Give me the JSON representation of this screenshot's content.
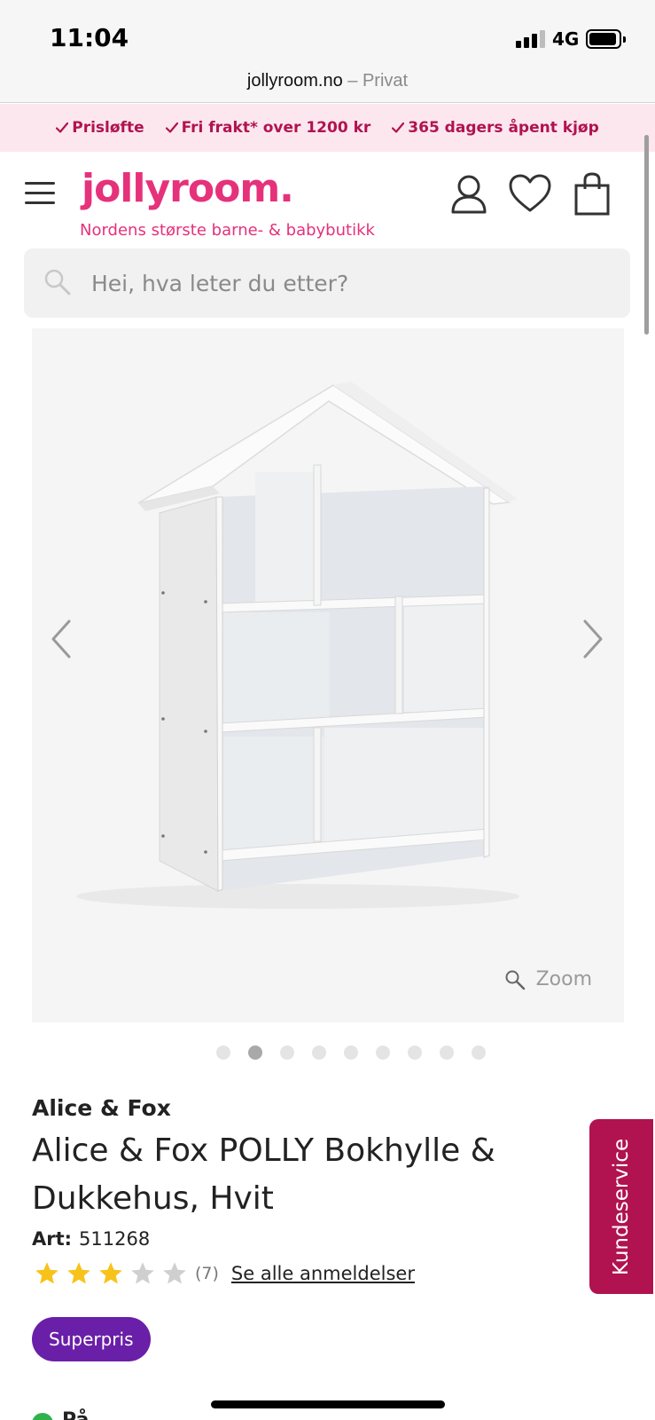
{
  "status_bar": {
    "time": "11:04",
    "network": "4G"
  },
  "browser": {
    "url": "jollyroom.no",
    "mode": " – Privat"
  },
  "promo": {
    "items": [
      "Prisløfte",
      "Fri frakt* over 1200 kr",
      "365 dagers åpent kjøp"
    ],
    "color": "#b0134f",
    "background": "#fde7ee"
  },
  "header": {
    "logo": "jollyroom.",
    "tagline": "Nordens største barne- & babybutikk",
    "brand_color": "#e6317b",
    "icons": [
      "menu-icon",
      "account-icon",
      "wishlist-icon",
      "cart-icon"
    ]
  },
  "search": {
    "placeholder": "Hei, hva leter du etter?"
  },
  "gallery": {
    "zoom_label": "Zoom",
    "slide_count": 9,
    "active_slide": 2
  },
  "product": {
    "brand": "Alice & Fox",
    "title": "Alice & Fox POLLY Bokhylle & Dukkehus, Hvit",
    "art_label": "Art:",
    "art_number": "511268",
    "rating": 3,
    "rating_max": 5,
    "review_count": "(7)",
    "reviews_link": "Se alle anmeldelser",
    "badge": "Superpris",
    "badge_color": "#6a1fa8"
  },
  "customer_service": {
    "label": "Kundeservice"
  },
  "stock": {
    "text": "På"
  }
}
